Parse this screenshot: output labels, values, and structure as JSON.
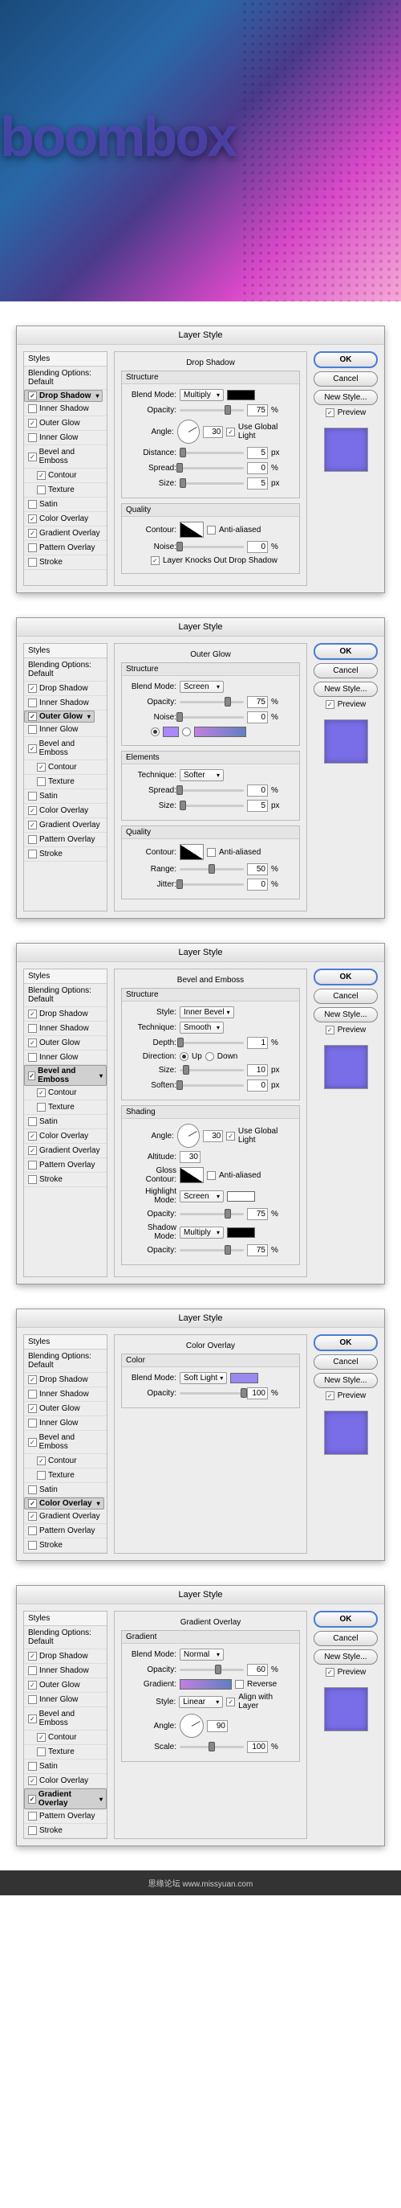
{
  "hero_text": "boombox",
  "footer": "思缘论坛   www.missyuan.com",
  "dialog_title": "Layer Style",
  "buttons": {
    "ok": "OK",
    "cancel": "Cancel",
    "new_style": "New Style...",
    "preview": "Preview"
  },
  "styles_header": "Styles",
  "styles_sub": "Blending Options: Default",
  "style_items": [
    {
      "label": "Drop Shadow",
      "on": true
    },
    {
      "label": "Inner Shadow",
      "on": false
    },
    {
      "label": "Outer Glow",
      "on": true
    },
    {
      "label": "Inner Glow",
      "on": false
    },
    {
      "label": "Bevel and Emboss",
      "on": true
    },
    {
      "label": "Contour",
      "on": true,
      "sub": true
    },
    {
      "label": "Texture",
      "on": false,
      "sub": true
    },
    {
      "label": "Satin",
      "on": false
    },
    {
      "label": "Color Overlay",
      "on": true
    },
    {
      "label": "Gradient Overlay",
      "on": true
    },
    {
      "label": "Pattern Overlay",
      "on": false
    },
    {
      "label": "Stroke",
      "on": false
    }
  ],
  "panels": [
    {
      "title": "Drop Shadow",
      "sel": "Drop Shadow",
      "sections": [
        {
          "h": "Structure",
          "rows": [
            {
              "t": "sel",
              "label": "Blend Mode:",
              "val": "Multiply",
              "swatch": "#000000"
            },
            {
              "t": "slider",
              "label": "Opacity:",
              "val": "75",
              "unit": "%",
              "pos": 75
            },
            {
              "t": "angle",
              "label": "Angle:",
              "val": "30",
              "cb": "Use Global Light",
              "cb_on": true
            },
            {
              "t": "slider",
              "label": "Distance:",
              "val": "5",
              "unit": "px",
              "pos": 5
            },
            {
              "t": "slider",
              "label": "Spread:",
              "val": "0",
              "unit": "%",
              "pos": 0
            },
            {
              "t": "slider",
              "label": "Size:",
              "val": "5",
              "unit": "px",
              "pos": 5
            }
          ]
        },
        {
          "h": "Quality",
          "rows": [
            {
              "t": "contour",
              "label": "Contour:",
              "cb": "Anti-aliased",
              "cb_on": false
            },
            {
              "t": "slider",
              "label": "Noise:",
              "val": "0",
              "unit": "%",
              "pos": 0
            },
            {
              "t": "cbrow",
              "cb": "Layer Knocks Out Drop Shadow",
              "cb_on": true
            }
          ]
        }
      ]
    },
    {
      "title": "Outer Glow",
      "sel": "Outer Glow",
      "sections": [
        {
          "h": "Structure",
          "rows": [
            {
              "t": "sel",
              "label": "Blend Mode:",
              "val": "Screen"
            },
            {
              "t": "slider",
              "label": "Opacity:",
              "val": "75",
              "unit": "%",
              "pos": 75
            },
            {
              "t": "slider",
              "label": "Noise:",
              "val": "0",
              "unit": "%",
              "pos": 0
            },
            {
              "t": "colorchoice",
              "swatch": "#aa88ff"
            }
          ]
        },
        {
          "h": "Elements",
          "rows": [
            {
              "t": "sel",
              "label": "Technique:",
              "val": "Softer"
            },
            {
              "t": "slider",
              "label": "Spread:",
              "val": "0",
              "unit": "%",
              "pos": 0
            },
            {
              "t": "slider",
              "label": "Size:",
              "val": "5",
              "unit": "px",
              "pos": 5
            }
          ]
        },
        {
          "h": "Quality",
          "rows": [
            {
              "t": "contour",
              "label": "Contour:",
              "cb": "Anti-aliased",
              "cb_on": false
            },
            {
              "t": "slider",
              "label": "Range:",
              "val": "50",
              "unit": "%",
              "pos": 50
            },
            {
              "t": "slider",
              "label": "Jitter:",
              "val": "0",
              "unit": "%",
              "pos": 0
            }
          ]
        }
      ]
    },
    {
      "title": "Bevel and Emboss",
      "sel": "Bevel and Emboss",
      "sections": [
        {
          "h": "Structure",
          "rows": [
            {
              "t": "sel",
              "label": "Style:",
              "val": "Inner Bevel"
            },
            {
              "t": "sel",
              "label": "Technique:",
              "val": "Smooth"
            },
            {
              "t": "slider",
              "label": "Depth:",
              "val": "1",
              "unit": "%",
              "pos": 1
            },
            {
              "t": "radio",
              "label": "Direction:",
              "opts": [
                "Up",
                "Down"
              ],
              "sel": 0
            },
            {
              "t": "slider",
              "label": "Size:",
              "val": "10",
              "unit": "px",
              "pos": 10
            },
            {
              "t": "slider",
              "label": "Soften:",
              "val": "0",
              "unit": "px",
              "pos": 0
            }
          ]
        },
        {
          "h": "Shading",
          "rows": [
            {
              "t": "angle2",
              "label": "Angle:",
              "val": "30",
              "alt": "30",
              "cb": "Use Global Light",
              "cb_on": true,
              "alt_label": "Altitude:"
            },
            {
              "t": "contour",
              "label": "Gloss Contour:",
              "cb": "Anti-aliased",
              "cb_on": false
            },
            {
              "t": "sel",
              "label": "Highlight Mode:",
              "val": "Screen",
              "swatch": "#ffffff"
            },
            {
              "t": "slider",
              "label": "Opacity:",
              "val": "75",
              "unit": "%",
              "pos": 75
            },
            {
              "t": "sel",
              "label": "Shadow Mode:",
              "val": "Multiply",
              "swatch": "#000000"
            },
            {
              "t": "slider",
              "label": "Opacity:",
              "val": "75",
              "unit": "%",
              "pos": 75
            }
          ]
        }
      ]
    },
    {
      "title": "Color Overlay",
      "sel": "Color Overlay",
      "sections": [
        {
          "h": "Color",
          "rows": [
            {
              "t": "sel",
              "label": "Blend Mode:",
              "val": "Soft Light",
              "swatch": "#9988ee"
            },
            {
              "t": "slider",
              "label": "Opacity:",
              "val": "100",
              "unit": "%",
              "pos": 100
            }
          ]
        }
      ]
    },
    {
      "title": "Gradient Overlay",
      "sel": "Gradient Overlay",
      "sections": [
        {
          "h": "Gradient",
          "rows": [
            {
              "t": "sel",
              "label": "Blend Mode:",
              "val": "Normal"
            },
            {
              "t": "slider",
              "label": "Opacity:",
              "val": "60",
              "unit": "%",
              "pos": 60
            },
            {
              "t": "grad",
              "label": "Gradient:",
              "cb": "Reverse",
              "cb_on": false
            },
            {
              "t": "sel",
              "label": "Style:",
              "val": "Linear",
              "cb": "Align with Layer",
              "cb_on": true
            },
            {
              "t": "angle",
              "label": "Angle:",
              "val": "90"
            },
            {
              "t": "slider",
              "label": "Scale:",
              "val": "100",
              "unit": "%",
              "pos": 50
            }
          ]
        }
      ]
    }
  ]
}
